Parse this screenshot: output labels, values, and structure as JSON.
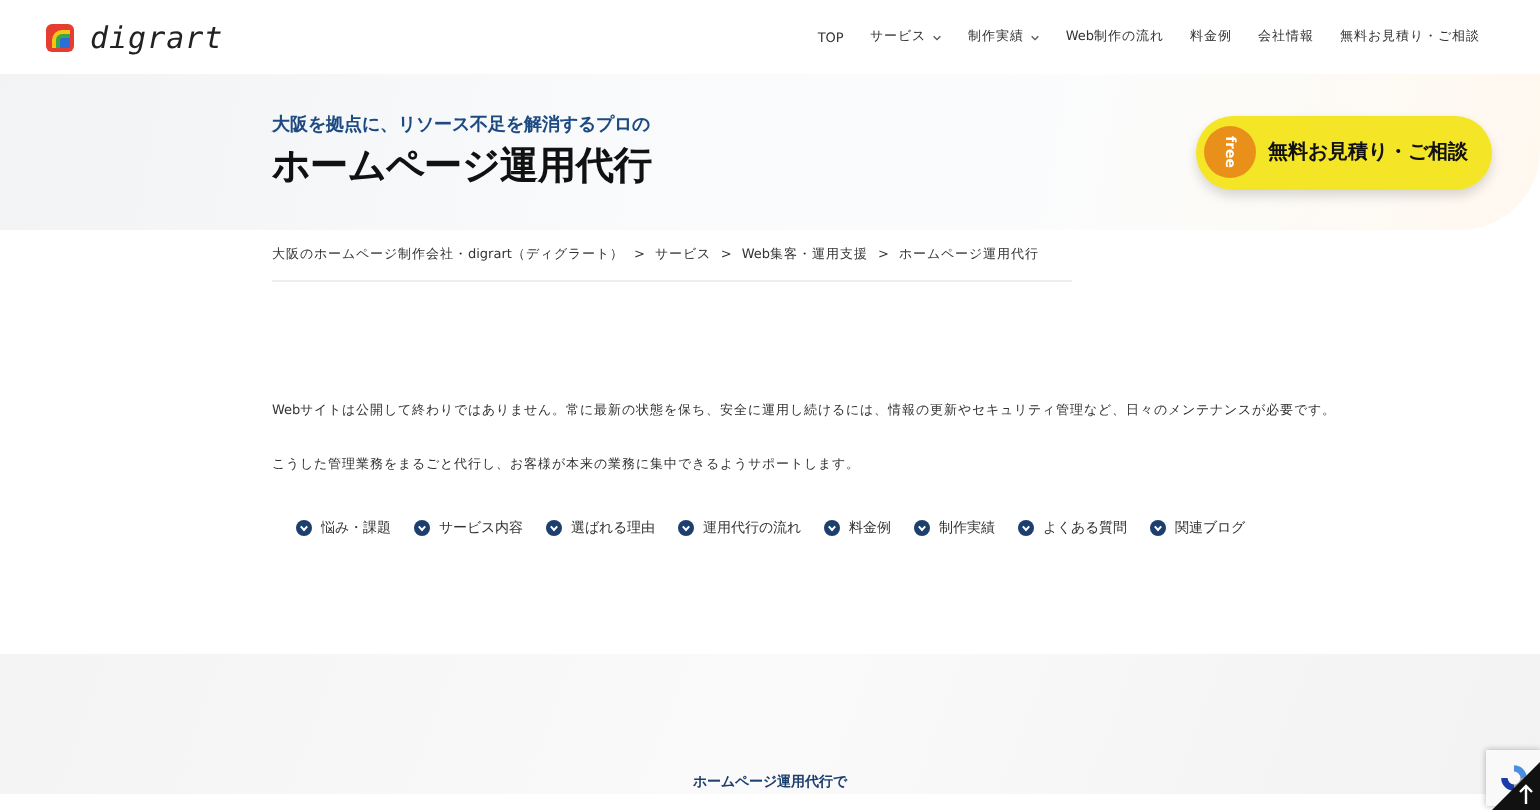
{
  "header": {
    "logo": "digrart",
    "nav": [
      {
        "label": "TOP",
        "has_menu": false
      },
      {
        "label": "サービス",
        "has_menu": true
      },
      {
        "label": "制作実績",
        "has_menu": true
      },
      {
        "label": "Web制作の流れ",
        "has_menu": false
      },
      {
        "label": "料金例",
        "has_menu": false
      },
      {
        "label": "会社情報",
        "has_menu": false
      },
      {
        "label": "無料お見積り・ご相談",
        "has_menu": false
      }
    ]
  },
  "hero": {
    "subtitle": "大阪を拠点に、リソース不足を解消するプロの",
    "title": "ホームページ運用代行",
    "cta": {
      "badge": "free",
      "label": "無料お見積り・ご相談"
    }
  },
  "breadcrumb": [
    "大阪のホームページ制作会社・digrart（ディグラート）",
    "サービス",
    "Web集客・運用支援",
    "ホームページ運用代行"
  ],
  "breadcrumb_separator": ">",
  "intro": [
    "Webサイトは公開して終わりではありません。常に最新の状態を保ち、安全に運用し続けるには、情報の更新やセキュリティ管理など、日々のメンテナンスが必要です。",
    "こうした管理業務をまるごと代行し、お客様が本来の業務に集中できるようサポートします。"
  ],
  "anchors": [
    "悩み・課題",
    "サービス内容",
    "選ばれる理由",
    "運用代行の流れ",
    "料金例",
    "制作実績",
    "よくある質問",
    "関連ブログ"
  ],
  "section": {
    "heading": "ホームページ運用代行で"
  }
}
